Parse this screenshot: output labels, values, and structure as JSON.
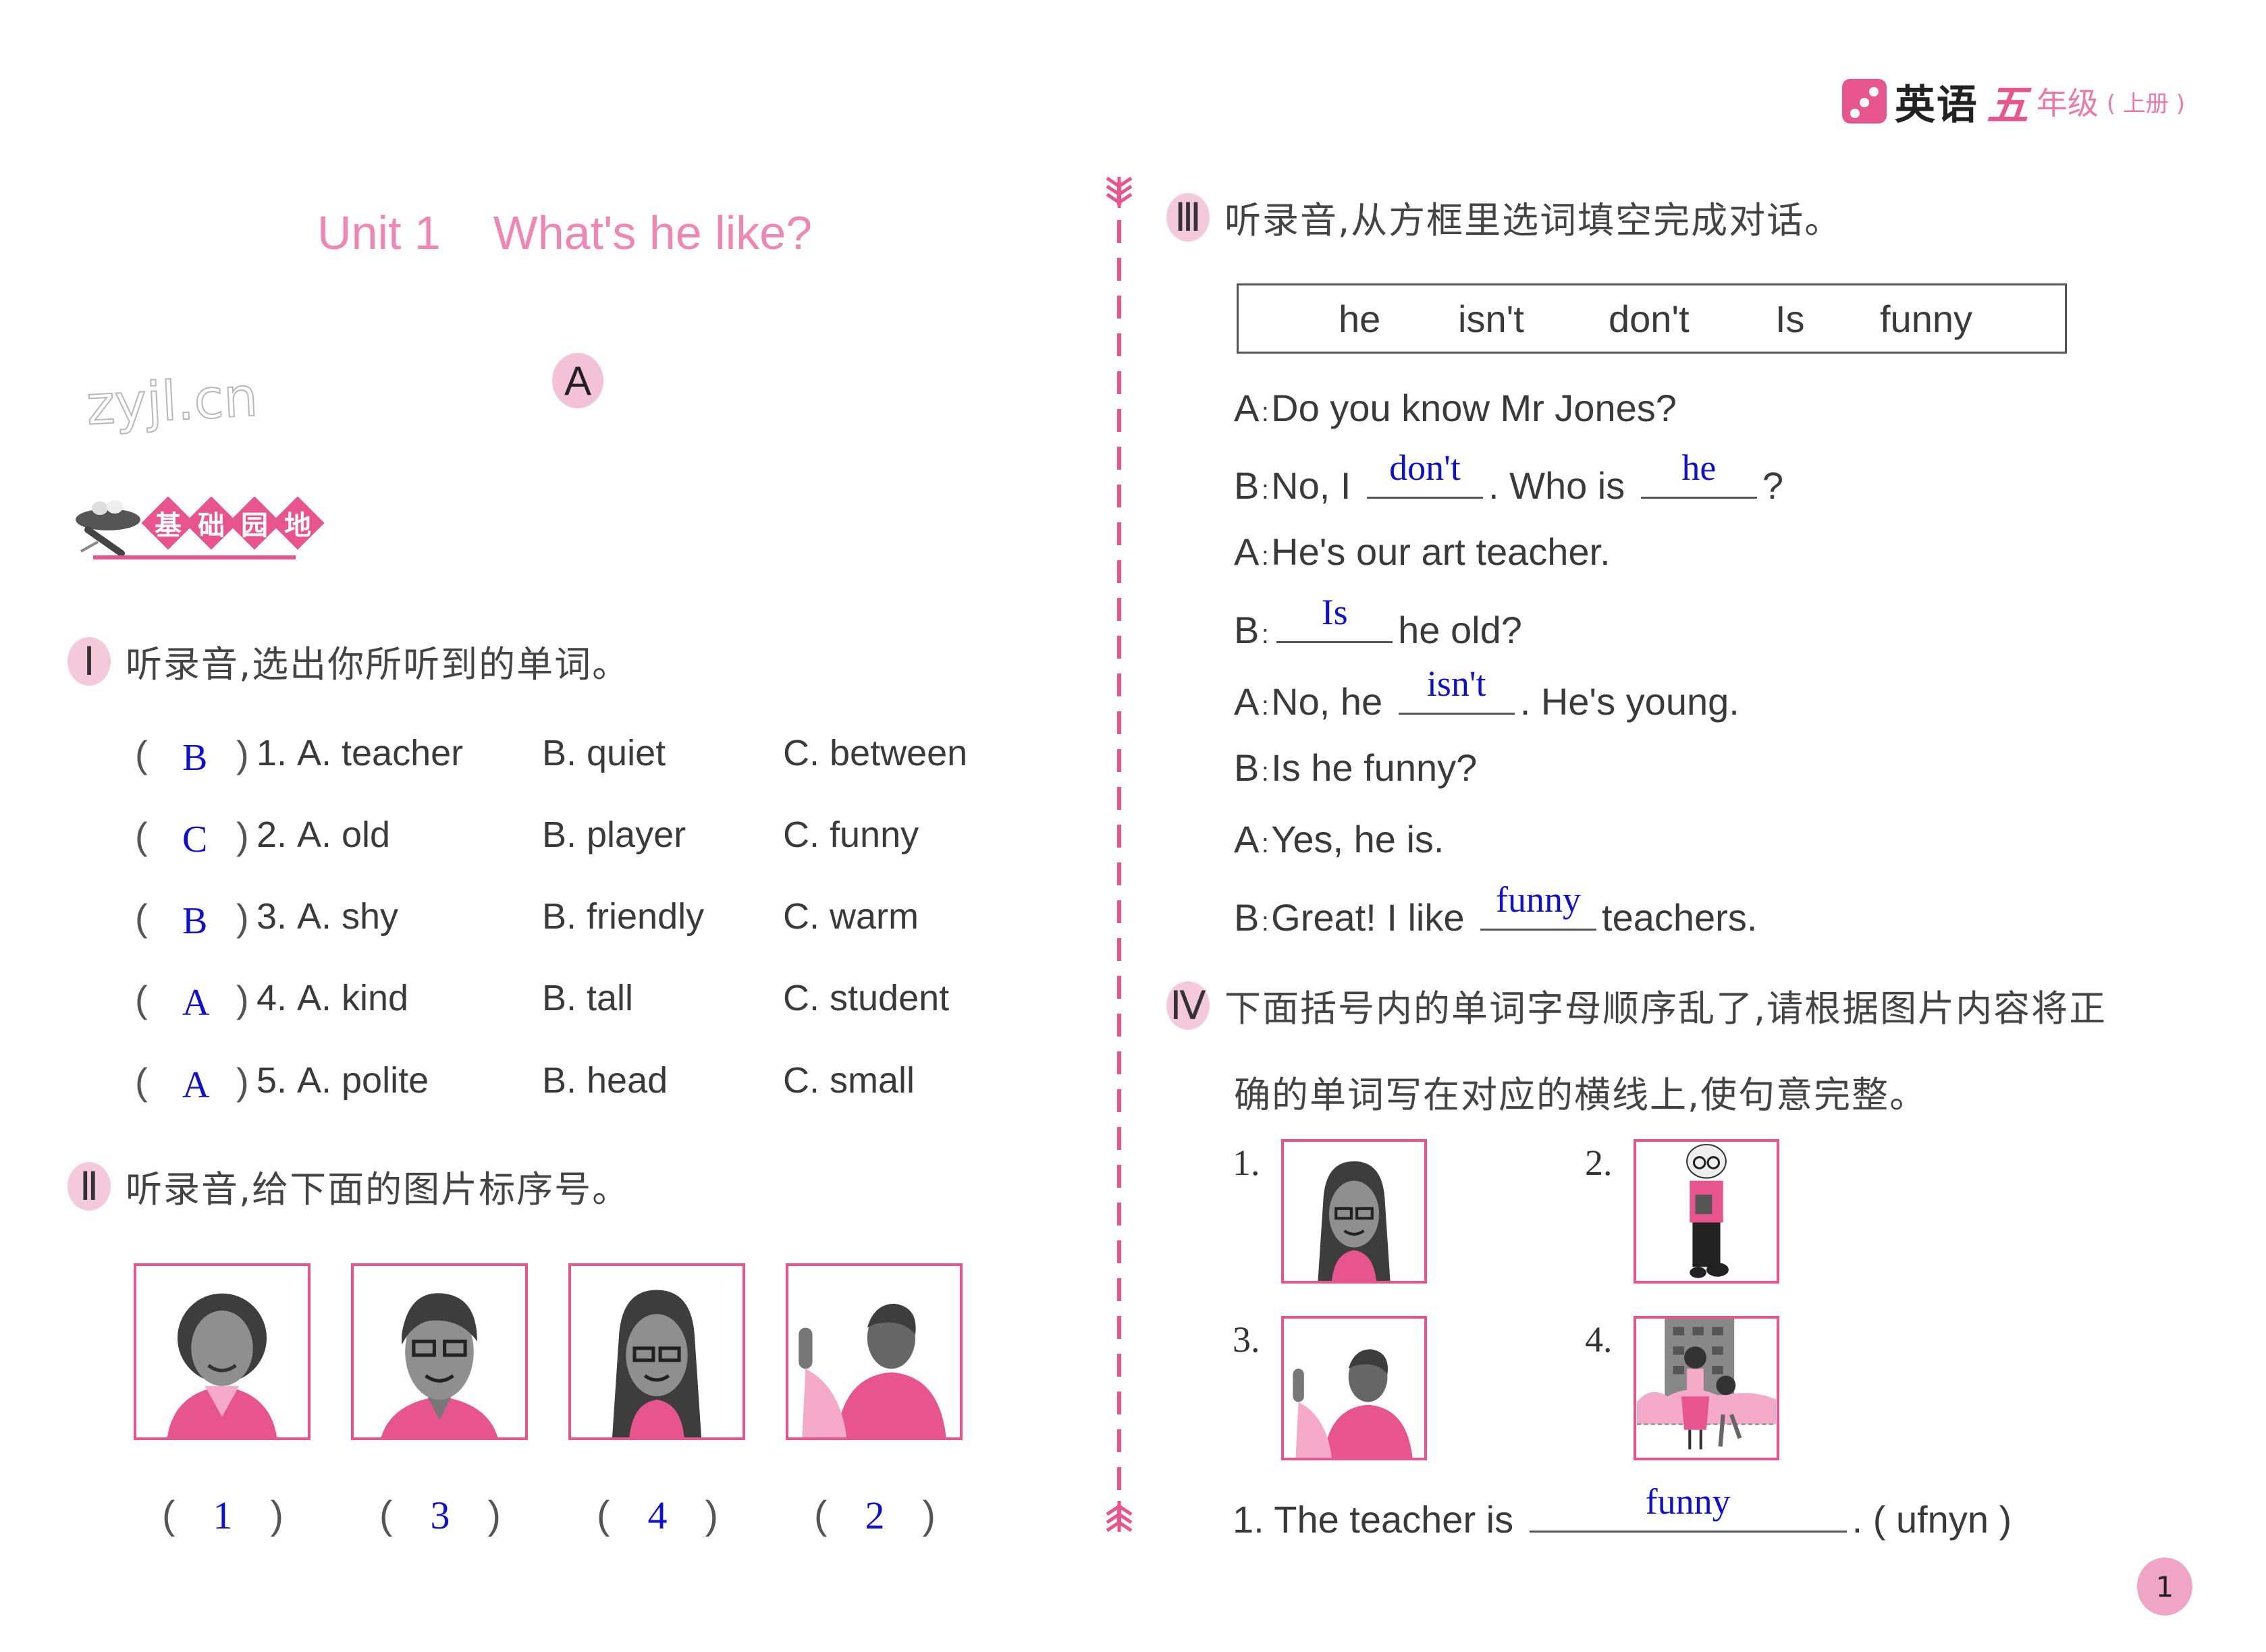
{
  "header": {
    "subject": "英语",
    "grade_number": "五",
    "grade_label": "年级",
    "volume": "( 上册 )"
  },
  "unit": {
    "title": "Unit 1    What's he like?",
    "section": "A"
  },
  "watermark": "zyjl.cn",
  "banner": {
    "chars": [
      "基",
      "础",
      "园",
      "地"
    ]
  },
  "q1": {
    "number": "Ⅰ",
    "instruction": "听录音,选出你所听到的单词。",
    "items": [
      {
        "answer": "B",
        "num": "1.",
        "a": "A. teacher",
        "b": "B. quiet",
        "c": "C. between"
      },
      {
        "answer": "C",
        "num": "2.",
        "a": "A. old",
        "b": "B. player",
        "c": "C. funny"
      },
      {
        "answer": "B",
        "num": "3.",
        "a": "A. shy",
        "b": "B. friendly",
        "c": "C. warm"
      },
      {
        "answer": "A",
        "num": "4.",
        "a": "A. kind",
        "b": "B. tall",
        "c": "C. student"
      },
      {
        "answer": "A",
        "num": "5.",
        "a": "A. polite",
        "b": "B. head",
        "c": "C. small"
      }
    ]
  },
  "q2": {
    "number": "Ⅱ",
    "instruction": "听录音,给下面的图片标序号。",
    "pictures": [
      {
        "subject": "older woman with curly hair",
        "answer": "1"
      },
      {
        "subject": "young man with glasses",
        "answer": "3"
      },
      {
        "subject": "woman with long hair and glasses",
        "answer": "4"
      },
      {
        "subject": "boy pointing finger up",
        "answer": "2"
      }
    ]
  },
  "q3": {
    "number": "Ⅲ",
    "instruction": "听录音,从方框里选词填空完成对话。",
    "word_box": [
      "he",
      "isn't",
      "don't",
      "Is",
      "funny"
    ],
    "dialogue": [
      {
        "speaker": "A",
        "parts": [
          "Do you know Mr Jones?"
        ]
      },
      {
        "speaker": "B",
        "pre": "No, I",
        "blank1": "don't",
        "mid": ".  Who is",
        "blank2": "he",
        "post": "?"
      },
      {
        "speaker": "A",
        "parts": [
          "He's our art teacher."
        ]
      },
      {
        "speaker": "B",
        "blank1": "Is",
        "post": "he old?"
      },
      {
        "speaker": "A",
        "pre": "No,  he",
        "blank1": "isn't",
        "post": ".  He's young."
      },
      {
        "speaker": "B",
        "parts": [
          "Is he funny?"
        ]
      },
      {
        "speaker": "A",
        "parts": [
          "Yes,  he is."
        ]
      },
      {
        "speaker": "B",
        "pre": "Great!  I like",
        "blank1": "funny",
        "post": "teachers."
      }
    ]
  },
  "q4": {
    "number": "Ⅳ",
    "instruction_line1": "下面括号内的单词字母顺序乱了,请根据图片内容将正",
    "instruction_line2": "确的单词写在对应的横线上,使句意完整。",
    "pictures": [
      {
        "label": "1.",
        "subject": "woman with long hair and glasses"
      },
      {
        "label": "2.",
        "subject": "old teacher holding a book"
      },
      {
        "label": "3.",
        "subject": "boy pointing finger up"
      },
      {
        "label": "4.",
        "subject": "woman and boy in front of building"
      }
    ],
    "sentence": {
      "pre": "1. The teacher is",
      "answer": "funny",
      "post": ". ( ufnyn )"
    }
  },
  "page_number": "1",
  "colors": {
    "accent": "#e8548e",
    "accent_light": "#f4c2d8",
    "answer_ink": "#1010d0",
    "text": "#3a3a3a"
  }
}
